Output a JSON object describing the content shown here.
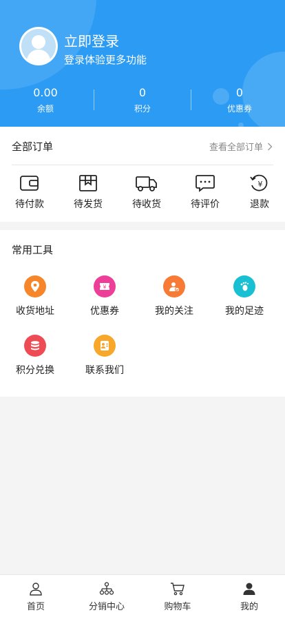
{
  "header": {
    "title": "立即登录",
    "subtitle": "登录体验更多功能",
    "bg_color": "#2b9bf4",
    "stats": [
      {
        "value": "0.00",
        "label": "余额"
      },
      {
        "value": "0",
        "label": "积分"
      },
      {
        "value": "0",
        "label": "优惠券"
      }
    ]
  },
  "orders": {
    "title": "全部订单",
    "view_all": "查看全部订单",
    "items": [
      {
        "label": "待付款",
        "icon": "wallet-icon"
      },
      {
        "label": "待发货",
        "icon": "box-icon"
      },
      {
        "label": "待收货",
        "icon": "truck-icon"
      },
      {
        "label": "待评价",
        "icon": "comment-icon"
      },
      {
        "label": "退款",
        "icon": "refund-icon"
      }
    ]
  },
  "tools": {
    "title": "常用工具",
    "items": [
      {
        "label": "收货地址",
        "icon": "location-icon",
        "color": "#f7862b"
      },
      {
        "label": "优惠券",
        "icon": "coupon-icon",
        "color": "#ee3f98"
      },
      {
        "label": "我的关注",
        "icon": "follow-icon",
        "color": "#f77a35"
      },
      {
        "label": "我的足迹",
        "icon": "footprint-icon",
        "color": "#19bfd3"
      },
      {
        "label": "积分兑换",
        "icon": "points-icon",
        "color": "#ef4b55"
      },
      {
        "label": "联系我们",
        "icon": "contact-icon",
        "color": "#f7a72a"
      }
    ]
  },
  "tabbar": {
    "items": [
      {
        "label": "首页",
        "icon": "home-icon"
      },
      {
        "label": "分销中心",
        "icon": "distribution-icon"
      },
      {
        "label": "购物车",
        "icon": "cart-icon"
      },
      {
        "label": "我的",
        "icon": "user-icon"
      }
    ]
  }
}
